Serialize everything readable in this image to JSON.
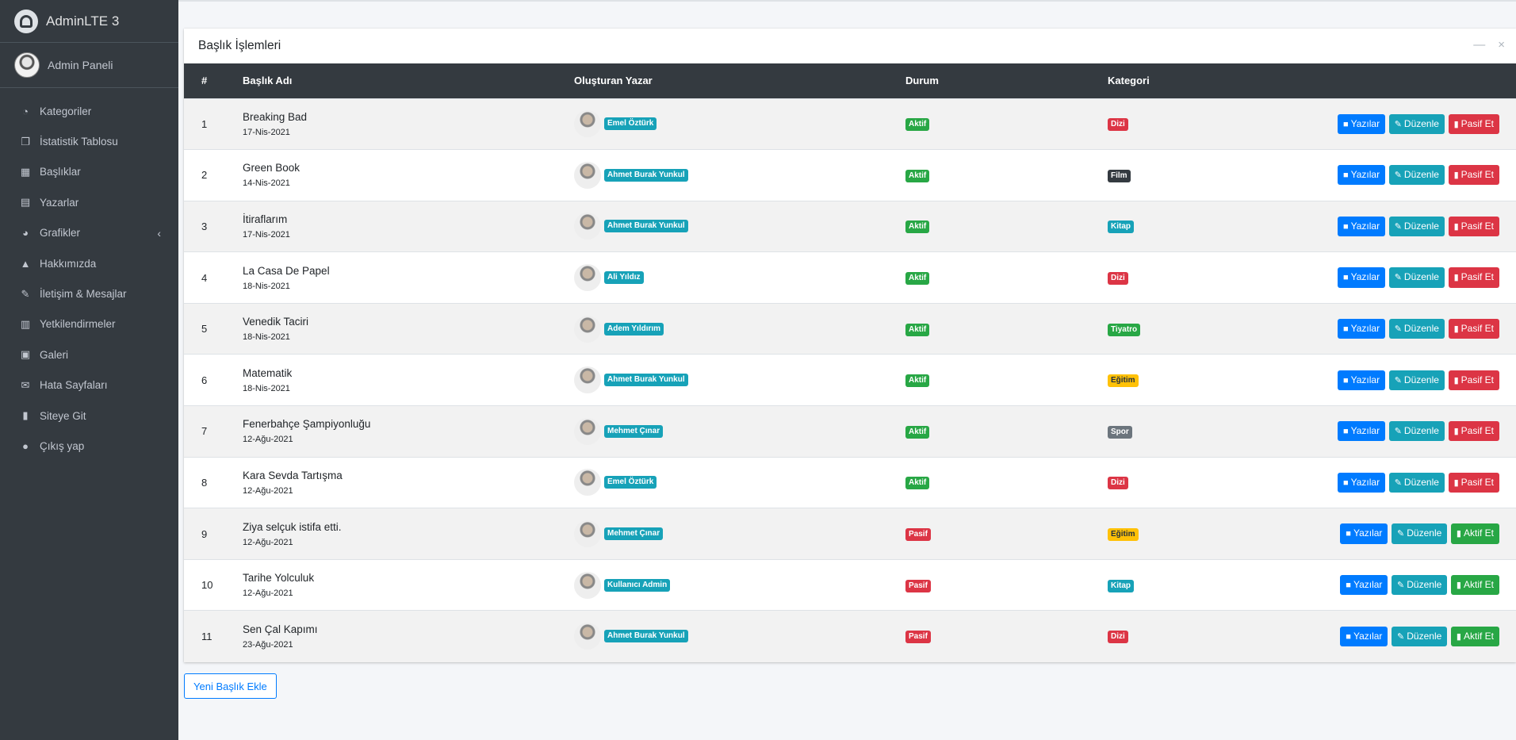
{
  "brand": "AdminLTE 3",
  "user": "Admin Paneli",
  "nav": [
    {
      "label": "Kategoriler",
      "icon": "tachometer-icon"
    },
    {
      "label": "İstatistik Tablosu",
      "icon": "copy-icon"
    },
    {
      "label": "Başlıklar",
      "icon": "grid-icon"
    },
    {
      "label": "Yazarlar",
      "icon": "file-icon"
    },
    {
      "label": "Grafikler",
      "icon": "pie-chart-icon"
    },
    {
      "label": "Hakkımızda",
      "icon": "tree-icon"
    },
    {
      "label": "İletişim & Mesajlar",
      "icon": "edit-icon"
    },
    {
      "label": "Yetkilendirmeler",
      "icon": "calendar-icon"
    },
    {
      "label": "Galeri",
      "icon": "image-icon"
    },
    {
      "label": "Hata Sayfaları",
      "icon": "envelope-icon"
    },
    {
      "label": "Siteye Git",
      "icon": "book-icon"
    },
    {
      "label": "Çıkış yap",
      "icon": "apple-icon"
    }
  ],
  "card": {
    "title": "Başlık İşlemleri",
    "columns": [
      "#",
      "Başlık Adı",
      "Oluşturan Yazar",
      "Durum",
      "Kategori"
    ]
  },
  "actions": {
    "posts": "Yazılar",
    "edit": "Düzenle",
    "deactivate": "Pasif Et",
    "activate": "Aktif Et"
  },
  "rows": [
    {
      "num": "1",
      "title": "Breaking Bad",
      "date": "17-Nis-2021",
      "author": "Emel Öztürk",
      "status": "Aktif",
      "category": "Dizi",
      "cat_style": "danger"
    },
    {
      "num": "2",
      "title": "Green Book",
      "date": "14-Nis-2021",
      "author": "Ahmet Burak Yunkul",
      "status": "Aktif",
      "category": "Film",
      "cat_style": "dark"
    },
    {
      "num": "3",
      "title": "İtiraflarım",
      "date": "17-Nis-2021",
      "author": "Ahmet Burak Yunkul",
      "status": "Aktif",
      "category": "Kitap",
      "cat_style": "info"
    },
    {
      "num": "4",
      "title": "La Casa De Papel",
      "date": "18-Nis-2021",
      "author": "Ali Yıldız",
      "status": "Aktif",
      "category": "Dizi",
      "cat_style": "danger"
    },
    {
      "num": "5",
      "title": "Venedik Taciri",
      "date": "18-Nis-2021",
      "author": "Adem Yıldırım",
      "status": "Aktif",
      "category": "Tiyatro",
      "cat_style": "success"
    },
    {
      "num": "6",
      "title": "Matematik",
      "date": "18-Nis-2021",
      "author": "Ahmet Burak Yunkul",
      "status": "Aktif",
      "category": "Eğitim",
      "cat_style": "warning"
    },
    {
      "num": "7",
      "title": "Fenerbahçe Şampiyonluğu",
      "date": "12-Ağu-2021",
      "author": "Mehmet Çınar",
      "status": "Aktif",
      "category": "Spor",
      "cat_style": "secondary"
    },
    {
      "num": "8",
      "title": "Kara Sevda Tartışma",
      "date": "12-Ağu-2021",
      "author": "Emel Öztürk",
      "status": "Aktif",
      "category": "Dizi",
      "cat_style": "danger"
    },
    {
      "num": "9",
      "title": "Ziya selçuk istifa etti.",
      "date": "12-Ağu-2021",
      "author": "Mehmet Çınar",
      "status": "Pasif",
      "category": "Eğitim",
      "cat_style": "warning"
    },
    {
      "num": "10",
      "title": "Tarihe Yolculuk",
      "date": "12-Ağu-2021",
      "author": "Kullanıcı Admin",
      "status": "Pasif",
      "category": "Kitap",
      "cat_style": "info"
    },
    {
      "num": "11",
      "title": "Sen Çal Kapımı",
      "date": "23-Ağu-2021",
      "author": "Ahmet Burak Yunkul",
      "status": "Pasif",
      "category": "Dizi",
      "cat_style": "danger"
    }
  ],
  "add_button": "Yeni Başlık Ekle"
}
